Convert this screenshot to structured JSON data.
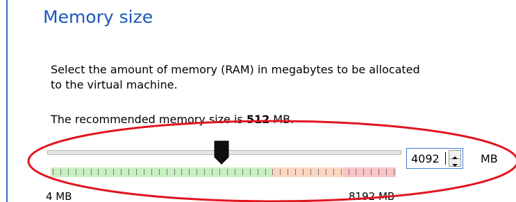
{
  "title": "Memory size",
  "description": "Select the amount of memory (RAM) in megabytes to be allocated\nto the virtual machine.",
  "recommendation": {
    "prefix": "The recommended memory size is ",
    "value": "512",
    "suffix": " MB."
  },
  "slider": {
    "min_label": "4 MB",
    "max_label": "8192 MB",
    "value_fraction": 0.5
  },
  "memory_input": {
    "value": "4092",
    "unit": "MB"
  },
  "colors": {
    "title": "#1a58b8",
    "highlight": "#e0141e",
    "zone_green": "#c9f0c2",
    "zone_orange": "#fbd6c2",
    "zone_red": "#f8c4c6"
  },
  "icons": {
    "slider_thumb": "slider-thumb-icon",
    "spin_up": "chevron-up-icon",
    "spin_down": "chevron-down-icon"
  }
}
